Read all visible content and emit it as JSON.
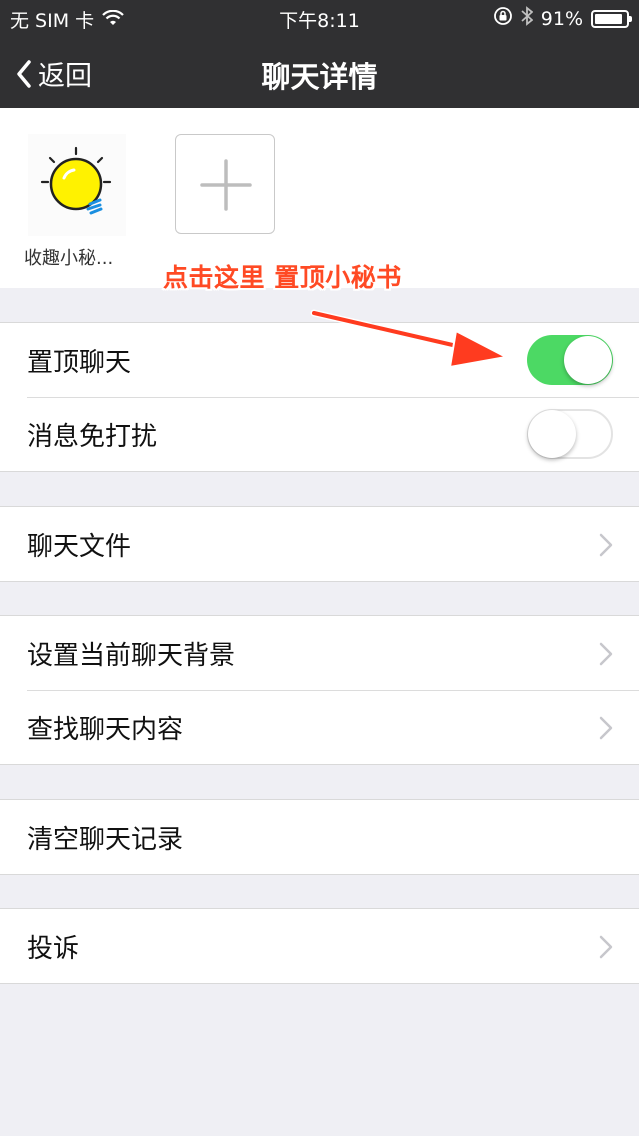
{
  "status_bar": {
    "carrier": "无 SIM 卡",
    "time": "下午8:11",
    "battery": "91%",
    "battery_level": 0.91
  },
  "nav": {
    "back_label": "返回",
    "title": "聊天详情"
  },
  "members": {
    "items": [
      {
        "name": "收趣小秘..."
      }
    ]
  },
  "annotation": {
    "text": "点击这里 置顶小秘书",
    "color": "#ff4a24"
  },
  "settings": {
    "group1": [
      {
        "label": "置顶聊天",
        "toggle": true
      },
      {
        "label": "消息免打扰",
        "toggle": false
      }
    ],
    "group2": [
      {
        "label": "聊天文件"
      }
    ],
    "group3": [
      {
        "label": "设置当前聊天背景"
      },
      {
        "label": "查找聊天内容"
      }
    ],
    "group4": [
      {
        "label": "清空聊天记录"
      }
    ],
    "group5": [
      {
        "label": "投诉"
      }
    ]
  },
  "colors": {
    "nav_bg": "#303032",
    "toggle_on": "#4cd964",
    "page_bg": "#efeff4"
  }
}
